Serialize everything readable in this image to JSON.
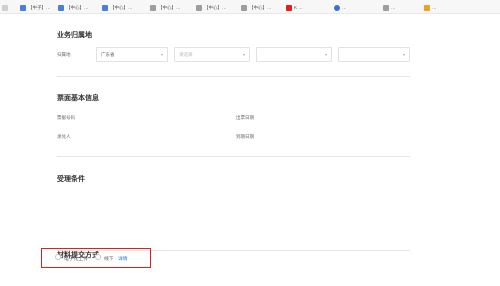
{
  "bookmarks": [
    {
      "label": "…",
      "color": "#cfcfcf"
    },
    {
      "label": "【中子】…",
      "color": "#4a7fd6"
    },
    {
      "label": "【中心】…",
      "color": "#4a7fd6"
    },
    {
      "label": "【中心】…",
      "color": "#4a7fd6"
    },
    {
      "label": "【中心】…",
      "color": "#9e9e9e"
    },
    {
      "label": "【中心】…",
      "color": "#9e9e9e"
    },
    {
      "label": "【中心】…",
      "color": "#9e9e9e"
    },
    {
      "label": "K …",
      "color": "#e0201a"
    },
    {
      "label": "…",
      "color": "#3b6fd8"
    },
    {
      "label": "…",
      "color": "#9e9e9e"
    },
    {
      "label": "…",
      "color": "#f0a020"
    }
  ],
  "business": {
    "title": "业务归属地",
    "label": "归属地",
    "province": "广东省",
    "city_placeholder": "请选择",
    "district_placeholder": "",
    "street_placeholder": ""
  },
  "basic": {
    "title": "票面基本信息",
    "rows": [
      {
        "label1": "票据号码",
        "value1": "",
        "label2": "出票日期",
        "value2": ""
      },
      {
        "label1": "承兑人",
        "value1": "",
        "label2": "到期日期",
        "value2": ""
      }
    ]
  },
  "conditions": {
    "title": "受理条件",
    "lines": [
      "",
      "",
      "",
      "",
      "",
      "",
      "",
      ""
    ]
  },
  "submit": {
    "title": "材料提交方式",
    "option_online": "电子化上传",
    "option_offline": "线下",
    "link": "详情"
  },
  "colors": {
    "highlight": "#e0201a",
    "link": "#2f6fd9"
  }
}
